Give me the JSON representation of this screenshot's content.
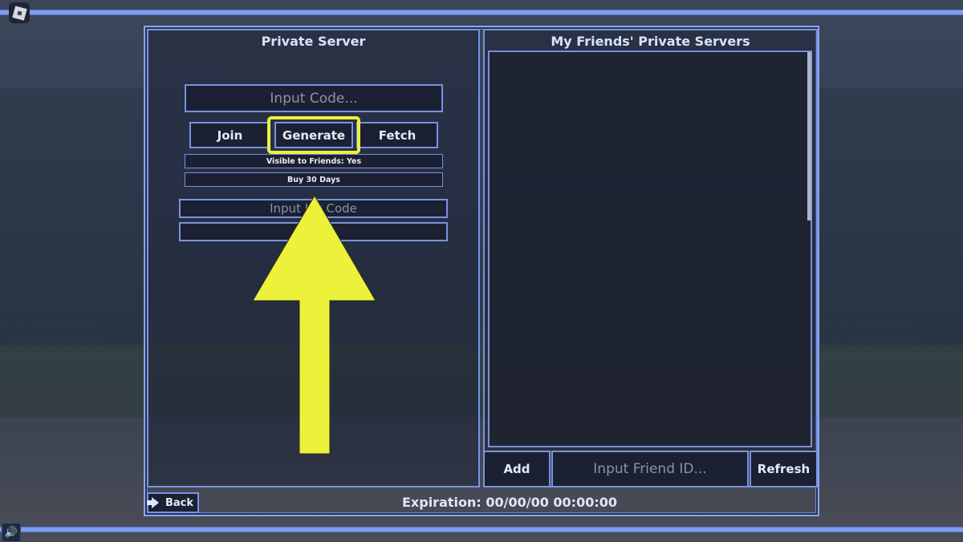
{
  "app": {
    "name": "Roblox"
  },
  "colors": {
    "accent": "#7893e0",
    "highlight": "#ecf23a",
    "panel_bg": "#1b2032",
    "text": "#e4eaf8",
    "placeholder": "#8d93a3"
  },
  "icons": {
    "menu": "roblox-logo-icon",
    "volume": "speaker-icon",
    "back": "arrow-icon",
    "annotation": "arrow-up-icon"
  },
  "private_server": {
    "title": "Private Server",
    "code_input": {
      "placeholder": "Input Code...",
      "value": ""
    },
    "buttons": {
      "join": "Join",
      "generate": "Generate",
      "fetch": "Fetch"
    },
    "visible_to_friends": "Visible to Friends: Yes",
    "buy": "Buy 30 Days",
    "legacy_input": {
      "placeholder_visible": "Input L     y Code"
    },
    "legacy_button": {
      "label": ""
    }
  },
  "friends_servers": {
    "title": "My Friends' Private Servers",
    "items": [],
    "add_label": "Add",
    "friend_input": {
      "placeholder": "Input Friend ID...",
      "value": ""
    },
    "refresh_label": "Refresh"
  },
  "footer": {
    "back_label": "Back",
    "expiration": "Expiration: 00/00/00 00:00:00"
  },
  "annotation": {
    "highlighted_button": "Generate",
    "arrow_color": "#ecf23a"
  }
}
